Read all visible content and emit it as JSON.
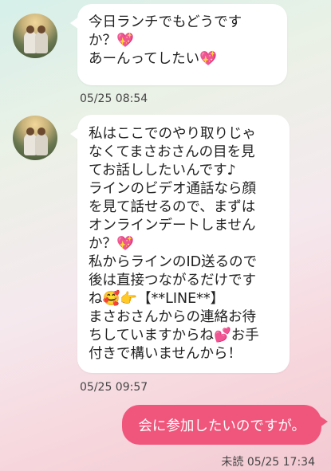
{
  "messages": [
    {
      "lines": [
        "今日ランチでもどうです",
        "か？💖",
        "あーんってしたい💖"
      ],
      "time": "05/25 08:54"
    },
    {
      "lines": [
        "私はここでのやり取りじゃ",
        "なくてまさおさんの目を見",
        "てお話ししたいんです♪",
        "ラインのビデオ通話なら顔",
        "を見て話せるので、まずは",
        "オンラインデートしません",
        "か？💖",
        "私からラインのID送るので",
        "後は直接つながるだけです",
        "ね🥰👉【**LINE**】",
        "まさおさんからの連絡お待",
        "ちしていますからね💕お手",
        "付きで構いませんから！"
      ],
      "time": "05/25 09:57"
    }
  ],
  "sent": {
    "text": "会に参加したいのですが。",
    "status": "未読",
    "time": "05/25 17:34"
  },
  "colors": {
    "sent_bubble": "#f0567c",
    "received_bubble": "#ffffff",
    "heart": "#ff4f9a"
  }
}
